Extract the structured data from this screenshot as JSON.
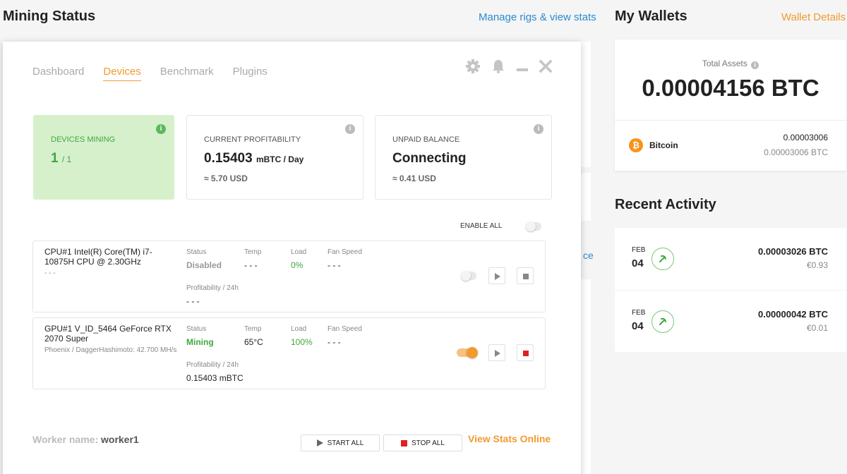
{
  "page": {
    "mining_status_title": "Mining Status",
    "manage_link": "Manage rigs & view stats",
    "my_wallets_title": "My Wallets",
    "wallet_details_link": "Wallet Details",
    "partial_link_text": "ce"
  },
  "wallet": {
    "total_label": "Total Assets",
    "total_value": "0.00004156 BTC",
    "coin_icon": "bitcoin-icon",
    "coin_name": "Bitcoin",
    "coin_amount": "0.00003006",
    "coin_amount_btc": "0.00003006 BTC"
  },
  "recent_activity": {
    "title": "Recent Activity",
    "items": [
      {
        "month": "FEB",
        "day": "04",
        "amount": "0.00003026 BTC",
        "fiat": "€0.93",
        "icon": "pickaxe-icon"
      },
      {
        "month": "FEB",
        "day": "04",
        "amount": "0.00000042 BTC",
        "fiat": "€0.01",
        "icon": "pickaxe-icon"
      }
    ]
  },
  "modal": {
    "tabs": [
      {
        "label": "Dashboard",
        "active": false
      },
      {
        "label": "Devices",
        "active": true
      },
      {
        "label": "Benchmark",
        "active": false
      },
      {
        "label": "Plugins",
        "active": false
      }
    ],
    "window_icons": [
      "gear-icon",
      "bell-icon",
      "minimize-icon",
      "close-icon"
    ],
    "stats": {
      "devices_mining": {
        "label": "DEVICES MINING",
        "value": "1",
        "total": "/ 1"
      },
      "profitability": {
        "label": "CURRENT PROFITABILITY",
        "value": "0.15403",
        "unit": "mBTC / Day",
        "sub": "≈ 5.70 USD"
      },
      "balance": {
        "label": "UNPAID BALANCE",
        "value": "Connecting",
        "sub": "≈ 0.41 USD"
      }
    },
    "enable_all_label": "ENABLE ALL",
    "enable_all_on": false,
    "column_labels": {
      "status": "Status",
      "temp": "Temp",
      "load": "Load",
      "fan": "Fan Speed",
      "profitability": "Profitability / 24h"
    },
    "devices": [
      {
        "name": "CPU#1 Intel(R) Core(TM) i7-10875H CPU @ 2.30GHz",
        "sub": "- - -",
        "status": "Disabled",
        "status_color": "#999999",
        "temp": "- - -",
        "load": "0%",
        "fan": "- - -",
        "profitability": "- - -",
        "enabled": false,
        "stop_color": "#888888"
      },
      {
        "name": "GPU#1 V_ID_5464 GeForce RTX 2070 Super",
        "sub": "Phoenix / DaggerHashimoto: 42.700 MH/s",
        "status": "Mining",
        "status_color": "#3ea73e",
        "temp": "65°C",
        "load": "100%",
        "fan": "- - -",
        "profitability": "0.15403 mBTC",
        "enabled": true,
        "stop_color": "#e02020"
      }
    ],
    "worker_label": "Worker name:",
    "worker_name": "worker1",
    "start_all": "START ALL",
    "stop_all": "STOP ALL",
    "view_stats": "View Stats Online",
    "colors": {
      "accent": "#f29a2e",
      "green": "#3ea73e",
      "link": "#2a8ad2"
    }
  }
}
